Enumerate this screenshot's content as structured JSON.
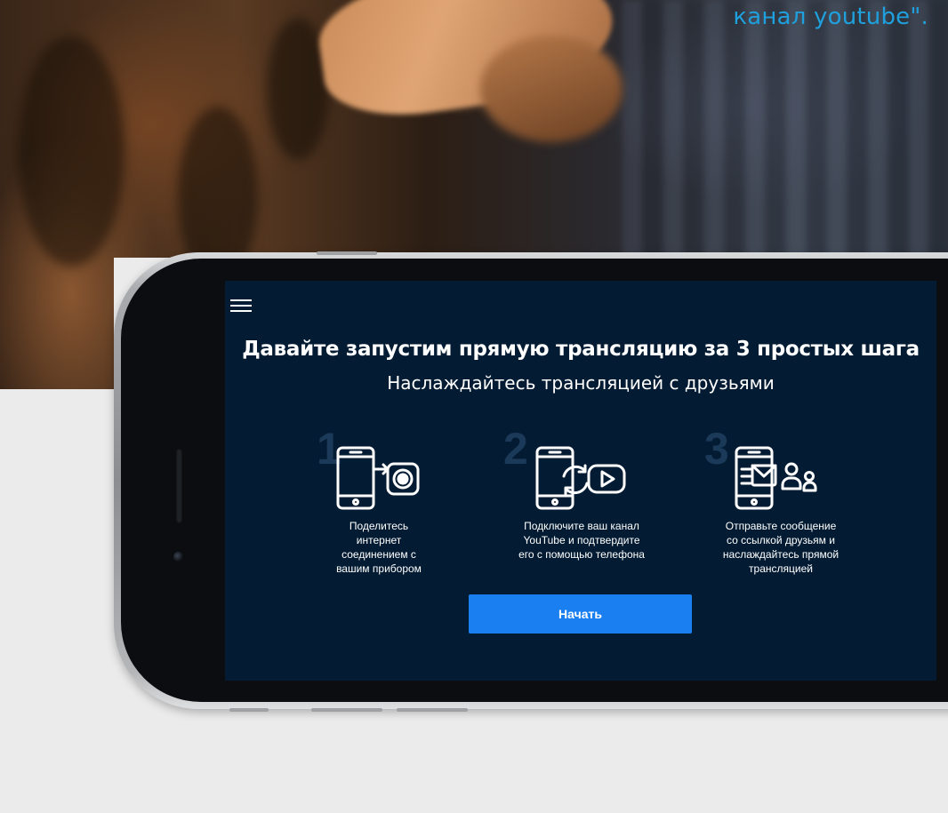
{
  "hero": {
    "caption": "канал youtube\"."
  },
  "app": {
    "menu_icon": "hamburger-menu-icon",
    "title": "Давайте запустим прямую трансляцию за 3 простых шага",
    "subtitle": "Наслаждайтесь трансляцией с друзьями",
    "steps": [
      {
        "number": "1",
        "icon": "phone-share-connection-icon",
        "lines": [
          "Поделитесь",
          "интернет",
          "соединением с",
          "вашим прибором"
        ]
      },
      {
        "number": "2",
        "icon": "phone-sync-youtube-icon",
        "lines": [
          "Подключите ваш канал",
          "YouTube и подтвердите",
          "его с помощью телефона"
        ]
      },
      {
        "number": "3",
        "icon": "phone-message-friends-icon",
        "lines": [
          "Отправьте сообщение",
          "со ссылкой друзьям и",
          "наслаждайтесь прямой",
          "трансляцией"
        ]
      }
    ],
    "start_button_label": "Начать",
    "colors": {
      "screen_background": "#041c33",
      "button": "#1a7ff0",
      "caption": "#1fa0dc",
      "step_number": "#1b3a59"
    }
  }
}
